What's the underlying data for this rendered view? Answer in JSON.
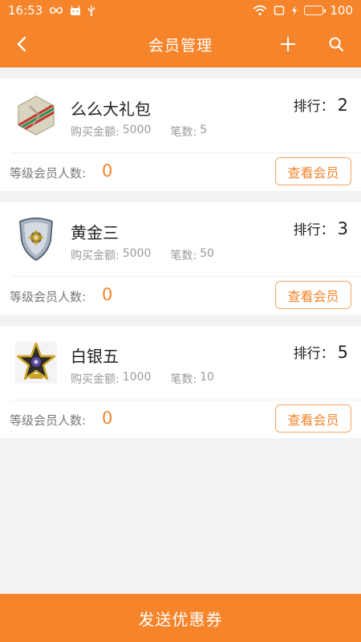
{
  "status_bar": {
    "time": "16:53",
    "battery": "100",
    "icons": [
      "infinity-icon",
      "android-icon",
      "usb-icon",
      "wifi-icon",
      "screen-icon",
      "charging-icon",
      "battery-icon"
    ]
  },
  "nav": {
    "title": "会员管理",
    "icons": [
      "back-arrow-icon",
      "plus-icon",
      "search-icon"
    ]
  },
  "labels": {
    "rank": "排行：",
    "amount": "购买金额:",
    "count": "笔数:",
    "member_count": "等级会员人数:",
    "view_button": "查看会员"
  },
  "levels": [
    {
      "name": "么么大礼包",
      "rank": "2",
      "amount": "5000",
      "count": "5",
      "members": "0",
      "badge_icon": "striped-hexagon-badge-icon"
    },
    {
      "name": "黄金三",
      "rank": "3",
      "amount": "5000",
      "count": "50",
      "members": "0",
      "badge_icon": "shield-crest-badge-icon"
    },
    {
      "name": "白银五",
      "rank": "5",
      "amount": "1000",
      "count": "10",
      "members": "0",
      "badge_icon": "star-medal-badge-icon"
    }
  ],
  "footer": {
    "button_label": "发送优惠券"
  },
  "colors": {
    "accent": "#f6842a",
    "background": "#f2f2f2",
    "card": "#ffffff",
    "muted_text": "#9a9a9a"
  }
}
